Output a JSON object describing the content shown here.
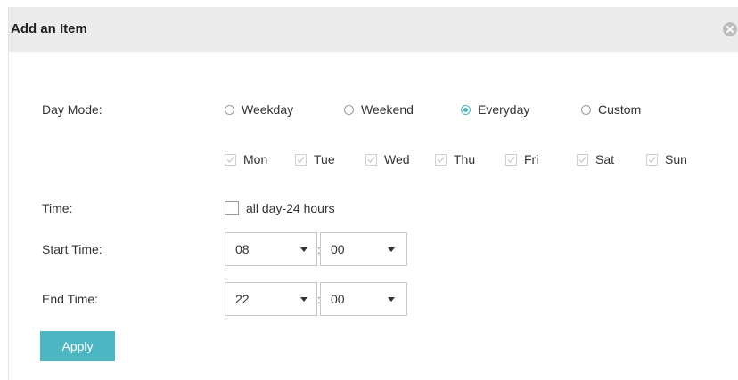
{
  "dialog": {
    "title": "Add an Item"
  },
  "labels": {
    "day_mode": "Day Mode:",
    "time": "Time:",
    "start_time": "Start Time:",
    "end_time": "End Time:"
  },
  "day_mode": {
    "options": [
      "Weekday",
      "Weekend",
      "Everyday",
      "Custom"
    ],
    "selected": "Everyday"
  },
  "days": [
    "Mon",
    "Tue",
    "Wed",
    "Thu",
    "Fri",
    "Sat",
    "Sun"
  ],
  "all_day": {
    "label": "all day-24 hours",
    "checked": false
  },
  "start_time": {
    "hour": "08",
    "minute": "00"
  },
  "end_time": {
    "hour": "22",
    "minute": "00"
  },
  "separator": ":",
  "apply_label": "Apply",
  "colors": {
    "accent": "#4db6c3",
    "header_bg": "#ececec"
  }
}
